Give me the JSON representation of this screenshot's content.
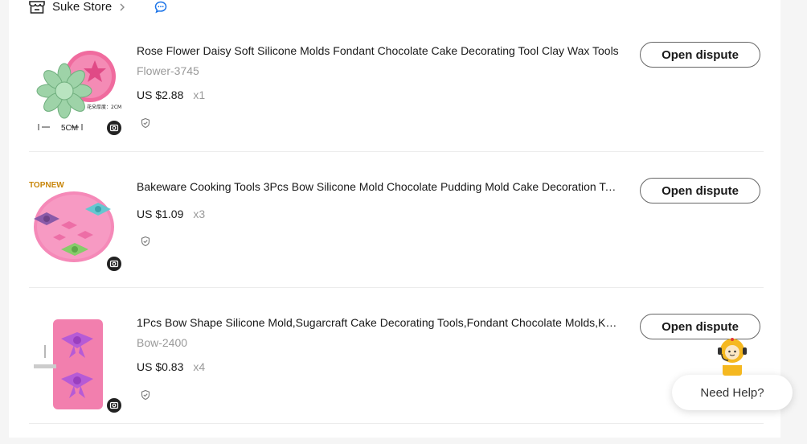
{
  "store": {
    "name": "Suke Store",
    "icon": "store-icon",
    "chat_icon": "chat-icon"
  },
  "orders": [
    {
      "title": "Rose Flower Daisy Soft Silicone Molds Fondant Chocolate Cake Decorating Tool Clay Wax Tools",
      "sku": "Flower-3745",
      "price": "US $2.88",
      "qty": "x1",
      "thumb_labels": [
        "5CM",
        "花朵厚度：2CM"
      ],
      "action": "Open dispute"
    },
    {
      "title": "Bakeware Cooking Tools 3Pcs Bow Silicone Mold Chocolate Pudding Mold Cake Decoration Tools",
      "sku": "",
      "price": "US $1.09",
      "qty": "x3",
      "thumb_labels": [
        "TOPNEW"
      ],
      "action": "Open dispute"
    },
    {
      "title": "1Pcs Bow Shape Silicone Mold,Sugarcraft Cake Decorating Tools,Fondant Chocolate Molds,Kitchen Tools",
      "sku": "Bow-2400",
      "price": "US $0.83",
      "qty": "x4",
      "thumb_labels": [],
      "action": "Open dispute"
    }
  ],
  "help": {
    "label": "Need Help?"
  }
}
